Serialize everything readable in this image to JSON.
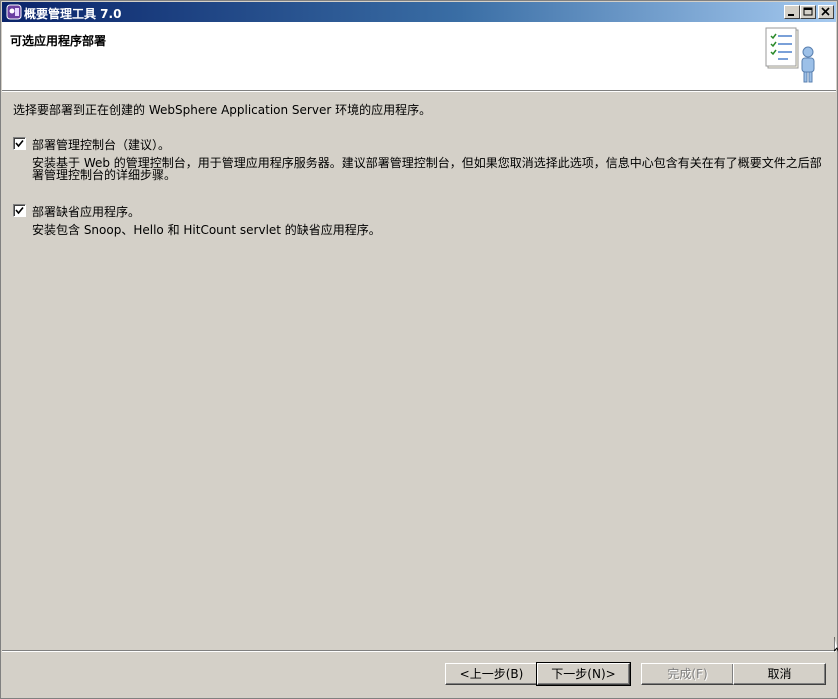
{
  "window": {
    "title": "概要管理工具 7.0"
  },
  "header": {
    "title": "可选应用程序部署",
    "graphic_icon": "document-person-icon"
  },
  "content": {
    "intro": "选择要部署到正在创建的 WebSphere Application Server 环境的应用程序。",
    "options": [
      {
        "label": "部署管理控制台（建议）。",
        "checked": true,
        "description": "安装基于 Web 的管理控制台，用于管理应用程序服务器。建议部署管理控制台，但如果您取消选择此选项，信息中心包含有关在有了概要文件之后部署管理控制台的详细步骤。"
      },
      {
        "label": "部署缺省应用程序。",
        "checked": true,
        "description": "安装包含 Snoop、Hello 和 HitCount servlet 的缺省应用程序。"
      }
    ]
  },
  "buttons": {
    "back": "<上一步(B)",
    "next": "下一步(N)>",
    "finish": "完成(F)",
    "cancel": "取消"
  },
  "colors": {
    "titlebar_start": "#0a246a",
    "titlebar_end": "#a6caf0",
    "face": "#d4d0c8"
  }
}
